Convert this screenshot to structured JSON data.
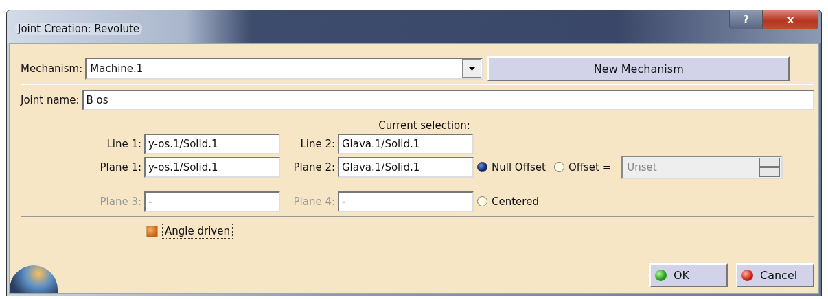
{
  "window": {
    "title": "Joint Creation: Revolute",
    "buttons": [
      {
        "kind": "help",
        "label": "?"
      },
      {
        "kind": "close",
        "label": "x"
      }
    ]
  },
  "mechanism": {
    "label": "Mechanism:",
    "value": "Machine.1",
    "button": "New Mechanism"
  },
  "joint_name": {
    "label": "Joint name:",
    "value": "B os"
  },
  "selection": {
    "heading": "Current selection:",
    "rows": [
      {
        "fields": [
          {
            "label": "Line 1:",
            "value": "y-os.1/Solid.1",
            "disabled": false
          },
          {
            "label": "Line 2:",
            "value": "Glava.1/Solid.1",
            "disabled": false
          }
        ],
        "options": []
      },
      {
        "fields": [
          {
            "label": "Plane 1:",
            "value": "y-os.1/Solid.1",
            "disabled": false
          },
          {
            "label": "Plane 2:",
            "value": "Glava.1/Solid.1",
            "disabled": false
          }
        ],
        "options": [
          {
            "kind": "radio",
            "label": "Null Offset",
            "selected": true
          },
          {
            "kind": "radio",
            "label": "Offset =",
            "selected": false
          },
          {
            "kind": "spinner",
            "value": "Unset",
            "disabled": true
          }
        ]
      },
      {
        "fields": [
          {
            "label": "Plane 3:",
            "value": "-",
            "disabled": true
          },
          {
            "label": "Plane 4:",
            "value": "-",
            "disabled": true
          }
        ],
        "options": [
          {
            "kind": "radio",
            "label": "Centered",
            "selected": false
          }
        ]
      }
    ]
  },
  "angle_driven": {
    "label": "Angle driven",
    "checked": true
  },
  "buttons": [
    {
      "kind": "ok",
      "label": "OK"
    },
    {
      "kind": "cancel",
      "label": "Cancel"
    }
  ]
}
